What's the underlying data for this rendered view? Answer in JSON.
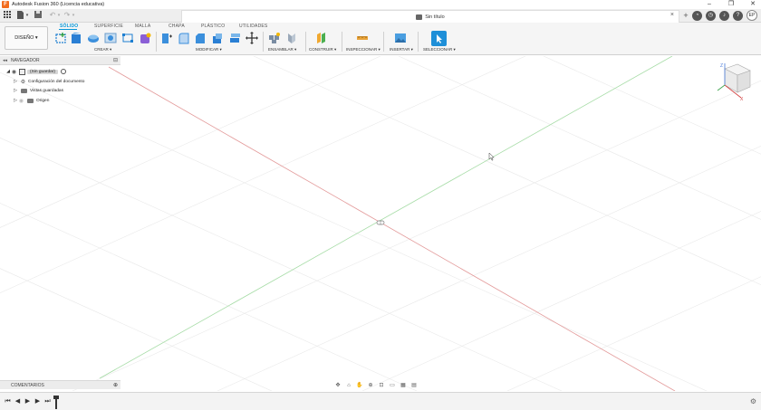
{
  "window": {
    "title": "Autodesk Fusion 360 (Licencia educativa)",
    "controls": [
      "–",
      "❐",
      "✕"
    ]
  },
  "appbar": {
    "document_tab": "Sin título",
    "user_initials": "EP"
  },
  "ribbon": {
    "workspace": "DISEÑO ▾",
    "tabs": [
      "SÓLIDO",
      "SUPERFICIE",
      "MALLA",
      "CHAPA",
      "PLÁSTICO",
      "UTILIDADES"
    ],
    "active_tab": "SÓLIDO",
    "groups": [
      "CREAR ▾",
      "MODIFICAR ▾",
      "ENSAMBLAR ▾",
      "CONSTRUIR ▾",
      "INSPECCIONAR ▾",
      "INSERTAR ▾",
      "SELECCIONAR ▾"
    ]
  },
  "browser": {
    "header": "NAVEGADOR",
    "items": [
      {
        "label": "(Sin guardar)"
      },
      {
        "label": "Configuración del documento"
      },
      {
        "label": "Vistas guardadas"
      },
      {
        "label": "Origen"
      }
    ]
  },
  "viewcube": {
    "z": "Z",
    "x": "X",
    "y": "Y"
  },
  "comments": {
    "label": "COMENTARIOS"
  },
  "colors": {
    "accent": "#0696d7",
    "x_axis": "#e07a7a",
    "y_axis": "#7fcf7f"
  }
}
